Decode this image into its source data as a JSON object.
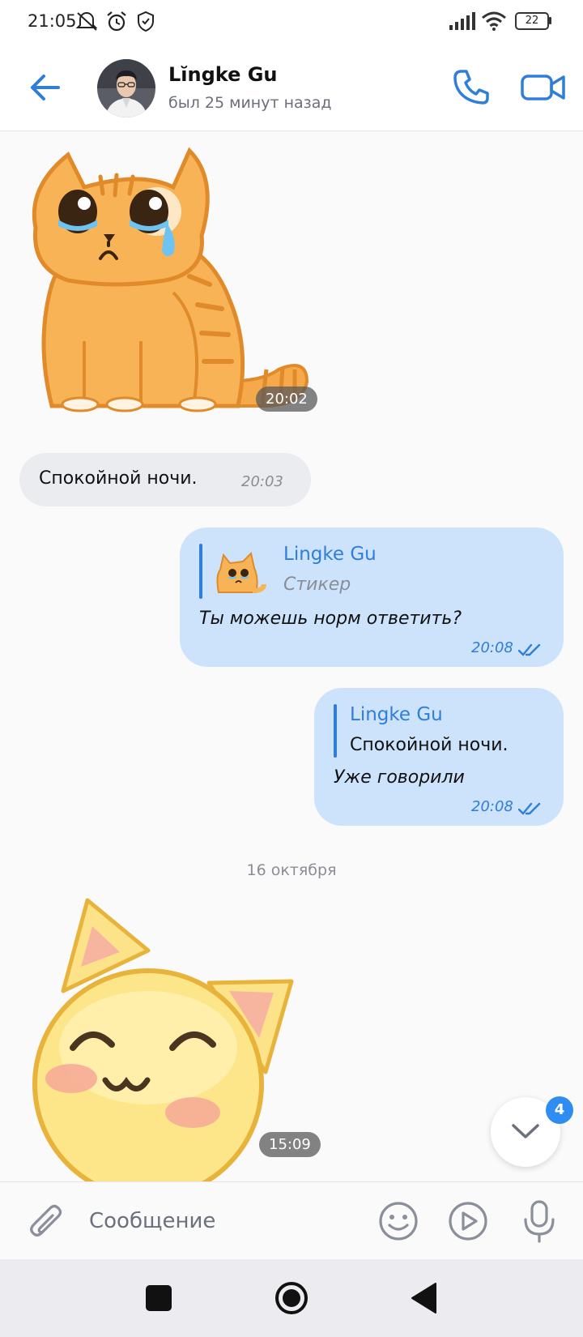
{
  "status_bar": {
    "time": "21:05",
    "battery": "22",
    "icons": [
      "mute-icon",
      "alarm-icon",
      "shield-icon",
      "signal-icon",
      "wifi-icon",
      "battery-icon"
    ]
  },
  "header": {
    "name": "Lĭngke Gu",
    "status": "был 25 минут назад",
    "icons": [
      "back-arrow-icon",
      "phone-icon",
      "video-camera-icon"
    ]
  },
  "messages": [
    {
      "type": "sticker",
      "direction": "in",
      "sticker": "crying-orange-cat",
      "time": "20:02"
    },
    {
      "type": "text",
      "direction": "in",
      "text": "Спокойной ночи.",
      "time": "20:03"
    },
    {
      "type": "reply",
      "direction": "out",
      "reply_to_name": "Lingke Gu",
      "reply_to_text": "Стикер",
      "text": "Ты можешь норм ответить?",
      "time": "20:08",
      "read": true
    },
    {
      "type": "reply",
      "direction": "out",
      "reply_to_name": "Lingke Gu",
      "reply_to_text": "Спокойной ночи.",
      "text": "Уже говорили",
      "time": "20:08",
      "read": true
    }
  ],
  "date_divider": "16 октября",
  "last_sticker": {
    "sticker": "smiling-yellow-cat",
    "time": "15:09"
  },
  "unread_count": "4",
  "input": {
    "placeholder": "Сообщение"
  },
  "colors": {
    "accent": "#2f7ed8",
    "bubble_out": "#cce3fb",
    "bubble_in": "#ebecf0"
  }
}
